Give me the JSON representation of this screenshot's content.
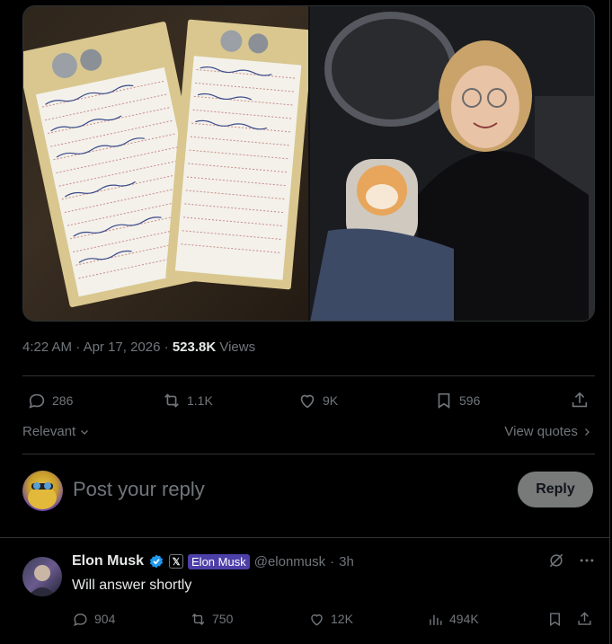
{
  "meta": {
    "time": "4:22 AM",
    "date": "Apr 17, 2026",
    "views_count": "523.8K",
    "views_label": "Views"
  },
  "actions": {
    "replies": "286",
    "reposts": "1.1K",
    "likes": "9K",
    "bookmarks": "596"
  },
  "sort": {
    "relevant": "Relevant",
    "view_quotes": "View quotes"
  },
  "composer": {
    "placeholder": "Post your reply",
    "reply_button": "Reply"
  },
  "reply": {
    "name": "Elon Musk",
    "x_badge": "𝕏",
    "affiliation": "Elon Musk",
    "handle": "@elonmusk",
    "time": "3h",
    "text": "Will answer shortly",
    "replies": "904",
    "reposts": "750",
    "likes": "12K",
    "views": "494K"
  },
  "colors": {
    "background": "#000000",
    "muted": "#71767b",
    "text": "#e7e9ea",
    "reply_button": "#787a7a",
    "affiliation": "#4c3fa8",
    "verified": "#1d9bf0"
  }
}
